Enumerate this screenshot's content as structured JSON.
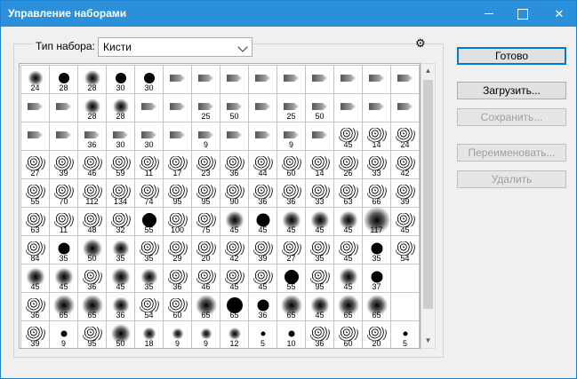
{
  "window": {
    "title": "Управление наборами",
    "minimize": "",
    "maximize": "",
    "close": "✕"
  },
  "preset": {
    "type_label": "Тип набора:",
    "type_value": "Кисти",
    "gear_icon": "⚙"
  },
  "buttons": {
    "done": "Готово",
    "load": "Загрузить...",
    "save": "Сохранить...",
    "rename": "Переименовать...",
    "delete": "Удалить"
  },
  "scroll": {
    "up": "▲",
    "down": "▼"
  },
  "brushes": [
    [
      "s:24",
      "h:28",
      "s:28",
      "h:30",
      "h:30",
      "t",
      "t",
      "t",
      "t",
      "t",
      "t",
      "t",
      "t",
      "t"
    ],
    [
      "t",
      "t",
      "s:28",
      "s:28",
      "t",
      "t",
      "t:25",
      "t:50",
      "t",
      "t:25",
      "t:50",
      "t",
      "t",
      "t"
    ],
    [
      "t",
      "t",
      "t:36",
      "t:30",
      "t:30",
      "t",
      "t:9",
      "t",
      "t",
      "t:9",
      "t",
      "x:45",
      "x:14",
      "x:24"
    ],
    [
      "x:27",
      "x:39",
      "x:46",
      "x:59",
      "x:11",
      "x:17",
      "x:23",
      "x:36",
      "x:44",
      "x:60",
      "x:14",
      "x:26",
      "x:33",
      "x:42"
    ],
    [
      "x:55",
      "x:70",
      "x:112",
      "x:134",
      "x:74",
      "x:95",
      "x:95",
      "x:90",
      "x:36",
      "x:36",
      "x:33",
      "x:63",
      "x:66",
      "x:39"
    ],
    [
      "x:63",
      "x:11",
      "x:48",
      "x:32",
      "h:55",
      "x:100",
      "x:75",
      "s:45",
      "h:45",
      "s:45",
      "s:45",
      "s:45",
      "s:117",
      "x:45"
    ],
    [
      "x:84",
      "h:35",
      "s:50",
      "s:35",
      "x:35",
      "x:29",
      "x:20",
      "x:42",
      "x:39",
      "x:27",
      "x:35",
      "x:45",
      "h:35",
      "x:54"
    ],
    [
      "s:45",
      "s:45",
      "x:36",
      "s:45",
      "s:35",
      "x:36",
      "x:46",
      "x:45",
      "x:45",
      "h:55",
      "x:95",
      "s:45",
      "h:37",
      ""
    ],
    [
      "x:36",
      "s:65",
      "s:65",
      "s:36",
      "x:54",
      "x:60",
      "s:65",
      "h:65",
      "h:36",
      "s:65",
      "s:45",
      "s:65",
      "s:65",
      ""
    ],
    [
      "x:39",
      "h:9",
      "x:95",
      "s:50",
      "s:18",
      "s:9",
      "s:9",
      "s:12",
      "h:5",
      "h:10",
      "x:36",
      "x:60",
      "x:20",
      "h:5"
    ]
  ]
}
